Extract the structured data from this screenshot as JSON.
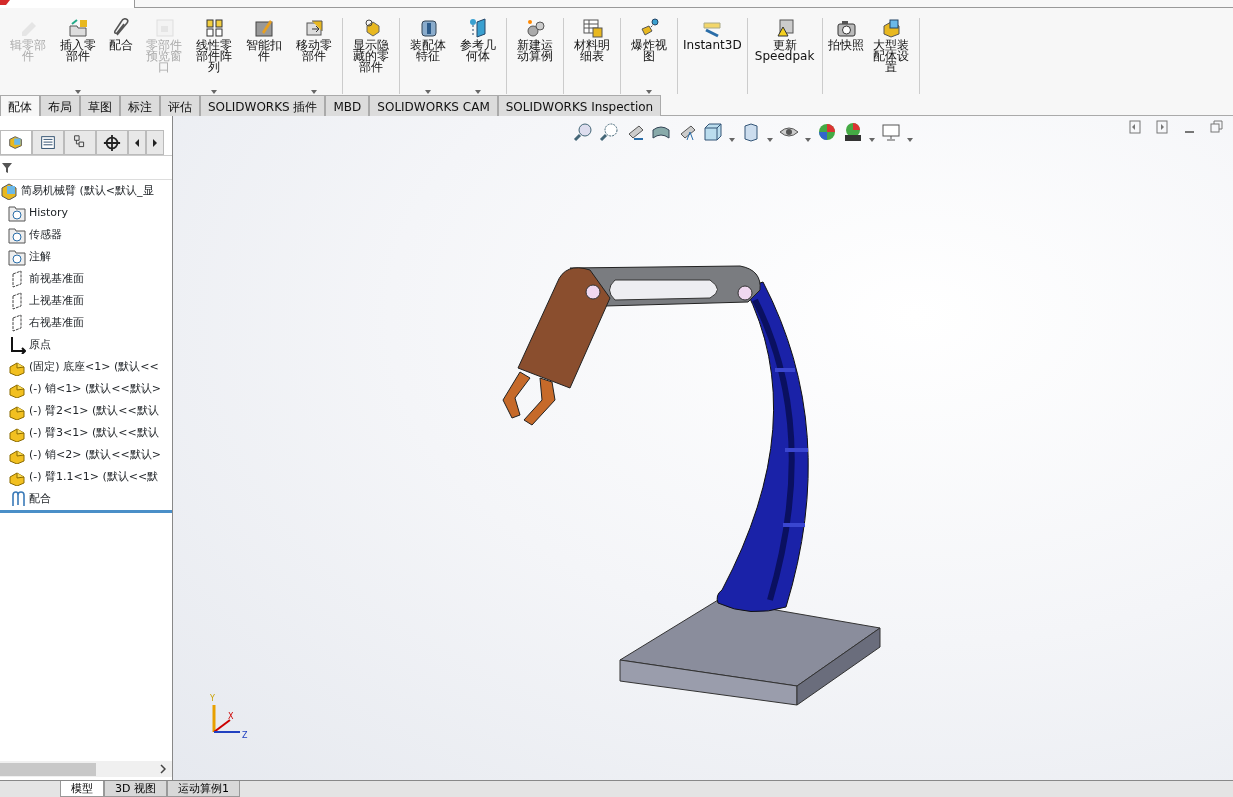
{
  "ribbon": {
    "groups": [
      {
        "buttons": [
          {
            "label": "辑零部件",
            "disabled": true,
            "dropdown": false
          },
          {
            "label": "插入零部件",
            "disabled": false,
            "dropdown": true
          },
          {
            "label": "配合",
            "disabled": false,
            "dropdown": false
          },
          {
            "label": "零部件预览窗口",
            "disabled": true,
            "dropdown": false
          },
          {
            "label": "线性零部件阵列",
            "disabled": false,
            "dropdown": true
          },
          {
            "label": "智能扣件",
            "disabled": false,
            "dropdown": false
          },
          {
            "label": "移动零部件",
            "disabled": false,
            "dropdown": true
          }
        ]
      },
      {
        "buttons": [
          {
            "label": "显示隐藏的零部件",
            "disabled": false,
            "dropdown": false
          }
        ]
      },
      {
        "buttons": [
          {
            "label": "装配体特征",
            "disabled": false,
            "dropdown": true
          },
          {
            "label": "参考几何体",
            "disabled": false,
            "dropdown": true
          }
        ]
      },
      {
        "buttons": [
          {
            "label": "新建运动算例",
            "disabled": false,
            "dropdown": false
          }
        ]
      },
      {
        "buttons": [
          {
            "label": "材料明细表",
            "disabled": false,
            "dropdown": false
          }
        ]
      },
      {
        "buttons": [
          {
            "label": "爆炸视图",
            "disabled": false,
            "dropdown": true
          }
        ]
      },
      {
        "buttons": [
          {
            "label": "Instant3D",
            "disabled": false,
            "dropdown": false
          }
        ]
      },
      {
        "buttons": [
          {
            "label": "更新 Speedpak",
            "disabled": false,
            "dropdown": false
          }
        ]
      },
      {
        "buttons": [
          {
            "label": "拍快照",
            "disabled": false,
            "dropdown": false
          },
          {
            "label": "大型装配体设置",
            "disabled": false,
            "dropdown": false
          }
        ]
      }
    ]
  },
  "tabs": [
    {
      "label": "配体",
      "selected": true
    },
    {
      "label": "布局",
      "selected": false
    },
    {
      "label": "草图",
      "selected": false
    },
    {
      "label": "标注",
      "selected": false
    },
    {
      "label": "评估",
      "selected": false
    },
    {
      "label": "SOLIDWORKS 插件",
      "selected": false
    },
    {
      "label": "MBD",
      "selected": false
    },
    {
      "label": "SOLIDWORKS CAM",
      "selected": false
    },
    {
      "label": "SOLIDWORKS Inspection",
      "selected": false
    }
  ],
  "panel_tabs": [
    {
      "selected": true
    },
    {
      "selected": false
    },
    {
      "selected": false
    },
    {
      "selected": false
    }
  ],
  "tree": {
    "root": "简易机械臂 (默认<默认_显",
    "children": [
      {
        "label": "History",
        "kind": "folder"
      },
      {
        "label": "传感器",
        "kind": "folder"
      },
      {
        "label": "注解",
        "kind": "folder"
      },
      {
        "label": "前视基准面",
        "kind": "plane"
      },
      {
        "label": "上视基准面",
        "kind": "plane"
      },
      {
        "label": "右视基准面",
        "kind": "plane"
      },
      {
        "label": "原点",
        "kind": "origin"
      },
      {
        "label": "(固定) 底座<1> (默认<<",
        "kind": "part"
      },
      {
        "label": "(-) 销<1> (默认<<默认>",
        "kind": "part"
      },
      {
        "label": "(-) 臂2<1> (默认<<默认",
        "kind": "part"
      },
      {
        "label": "(-) 臂3<1> (默认<<默认",
        "kind": "part"
      },
      {
        "label": "(-) 销<2> (默认<<默认>",
        "kind": "part"
      },
      {
        "label": "(-) 臂1.1<1> (默认<<默",
        "kind": "part"
      },
      {
        "label": "配合",
        "kind": "mate"
      }
    ]
  },
  "axis_labels": [
    "Y",
    "X",
    "Z"
  ],
  "bottom_tabs": [
    {
      "label": "模型",
      "selected": true
    },
    {
      "label": "3D 视图",
      "selected": false
    },
    {
      "label": "运动算例1",
      "selected": false
    }
  ]
}
